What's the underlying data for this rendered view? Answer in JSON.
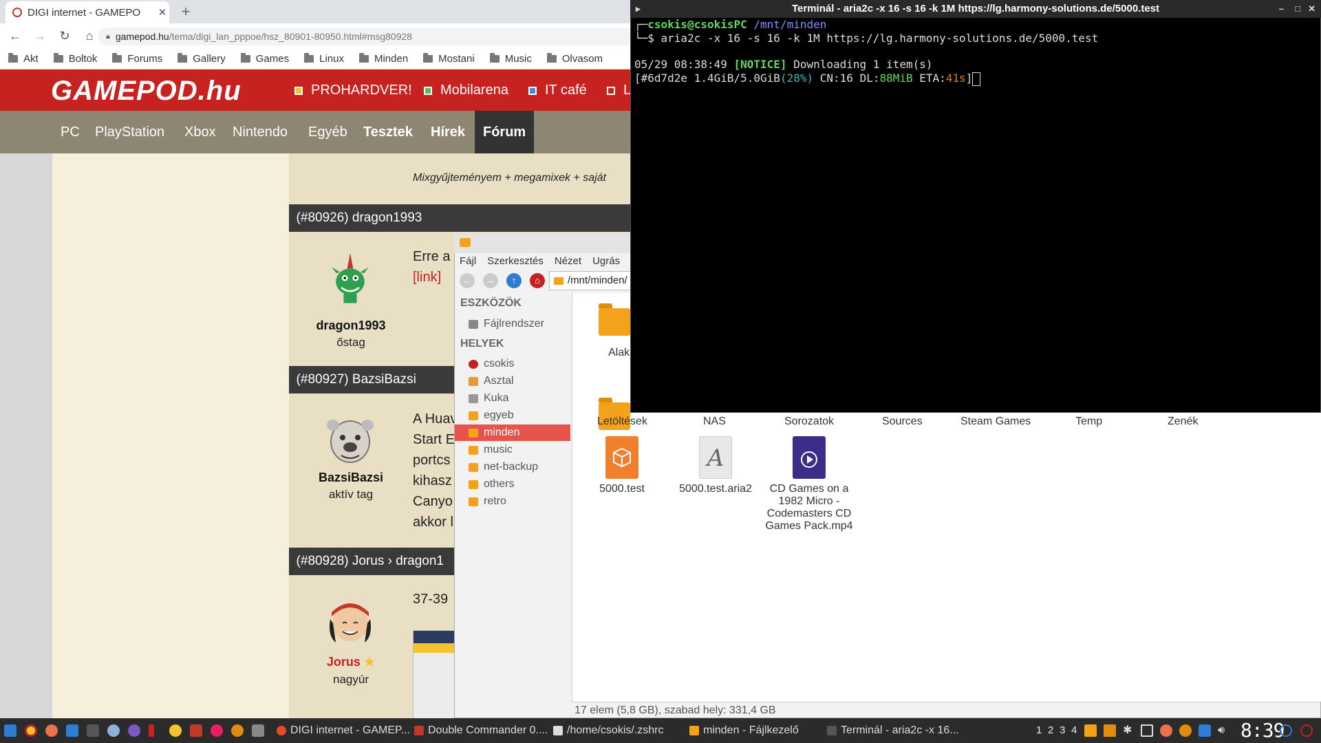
{
  "browser": {
    "tab_title": "DIGI internet - GAMEPO",
    "address_host": "gamepod.hu",
    "address_path": "/tema/digi_lan_pppoe/hsz_80901-80950.html#msg80928",
    "bookmarks": [
      "Akt",
      "Boltok",
      "Forums",
      "Gallery",
      "Games",
      "Linux",
      "Minden",
      "Mostani",
      "Music",
      "Olvasom"
    ]
  },
  "site": {
    "logo": "GAMEPOD.hu",
    "partners": [
      {
        "label": "PROHARDVER!",
        "color": "#f4c430"
      },
      {
        "label": "Mobilarena",
        "color": "#5cb85c"
      },
      {
        "label": "IT café",
        "color": "#3a8fd8"
      },
      {
        "label": "L",
        "color": "#ffffff"
      }
    ],
    "nav": [
      "PC",
      "PlayStation",
      "Xbox",
      "Nintendo",
      "Egyéb",
      "Tesztek",
      "Hírek",
      "Fórum"
    ],
    "signature_text": "Mixgyűjteményem + megamixek + saját",
    "posts": [
      {
        "header_num": "#80926",
        "header_user": "dragon1993",
        "user": "dragon1993",
        "rank": "őstag",
        "text_lines": [
          "Erre a"
        ],
        "link": "[link]"
      },
      {
        "header_num": "#80927",
        "header_user": "BazsiBazsi",
        "user": "BazsiBazsi",
        "rank": "aktív tag",
        "text_lines": [
          "A Huav",
          "Start E",
          "portcs",
          "kihasz",
          "Canyo",
          "akkor l"
        ]
      },
      {
        "header_num": "#80928",
        "header_user": "Jorus",
        "header_reply": "dragon1",
        "user": "Jorus",
        "rank": "nagyúr",
        "text_lines": [
          "37-39"
        ]
      }
    ]
  },
  "file_manager": {
    "menu": [
      "Fájl",
      "Szerkesztés",
      "Nézet",
      "Ugrás"
    ],
    "path": "/mnt/minden/",
    "sidebar_tools_header": "ESZKÖZÖK",
    "sidebar_tools": [
      {
        "label": "Fájlrendszer",
        "icon": "drive-icon"
      }
    ],
    "sidebar_places_header": "HELYEK",
    "sidebar_places": [
      {
        "label": "csokis",
        "icon": "home-icon"
      },
      {
        "label": "Asztal",
        "icon": "desktop-icon"
      },
      {
        "label": "Kuka",
        "icon": "trash-icon"
      },
      {
        "label": "egyeb",
        "icon": "folder-icon"
      },
      {
        "label": "minden",
        "icon": "folder-icon",
        "selected": true
      },
      {
        "label": "music",
        "icon": "folder-icon"
      },
      {
        "label": "net-backup",
        "icon": "folder-icon"
      },
      {
        "label": "others",
        "icon": "folder-icon"
      },
      {
        "label": "retro",
        "icon": "folder-icon"
      }
    ],
    "items_row1_partial": [
      "Alak"
    ],
    "items_row2": [
      "Letöltések",
      "NAS",
      "Sorozatok",
      "Sources",
      "Steam Games",
      "Temp",
      "Zenék"
    ],
    "files": [
      {
        "name": "5000.test",
        "type": "package"
      },
      {
        "name": "5000.test.aria2",
        "type": "text"
      },
      {
        "name": "CD Games on a 1982 Micro - Codemasters CD Games Pack.mp4",
        "type": "video"
      }
    ],
    "status": "17 elem (5,8 GB), szabad hely: 331,4 GB"
  },
  "terminal": {
    "title": "Terminál - aria2c -x 16 -s 16 -k 1M https://lg.harmony-solutions.de/5000.test",
    "prompt_user": "csokis@csokisPC",
    "prompt_dir": "/mnt/minden",
    "command": "aria2c -x 16 -s 16 -k 1M https://lg.harmony-solutions.de/5000.test",
    "notice_time": "05/29 08:38:49",
    "notice_tag": "[NOTICE]",
    "notice_msg": "Downloading 1 item(s)",
    "progress_id": "[#6d7d2e",
    "progress_size": "1.4GiB/5.0GiB",
    "progress_pct": "(28%)",
    "progress_cn": "CN:16",
    "progress_dl_label": "DL:",
    "progress_dl": "88MiB",
    "progress_eta_label": "ETA:",
    "progress_eta": "41s",
    "progress_end": "]"
  },
  "taskbar": {
    "tasks": [
      {
        "label": "DIGI internet - GAMEP...",
        "color": "#e34c26"
      },
      {
        "label": "Double Commander 0....",
        "color": "#c0392b"
      },
      {
        "label": "/home/csokis/.zshrc",
        "color": "#dddddd"
      },
      {
        "label": "minden - Fájlkezelő",
        "color": "#f4a21b"
      },
      {
        "label": "Terminál - aria2c -x 16...",
        "color": "#555555"
      }
    ],
    "workspaces": [
      "1",
      "2",
      "3",
      "4"
    ],
    "clock": "8:39"
  }
}
